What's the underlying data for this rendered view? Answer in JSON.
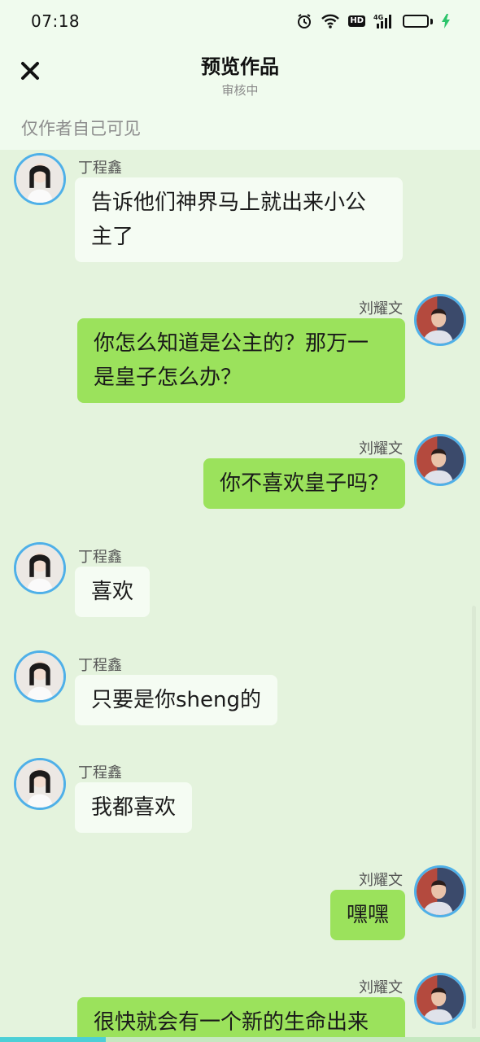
{
  "status_bar": {
    "time": "07:18",
    "icons": [
      "alarm-icon",
      "wifi-icon",
      "hd-icon",
      "4g-signal-icon",
      "battery-icon",
      "charging-icon"
    ],
    "hd_label": "HD",
    "network_label": "4G"
  },
  "header": {
    "title": "预览作品",
    "subtitle": "审核中",
    "visibility_note": "仅作者自己可见",
    "close_icon": "close-icon"
  },
  "messages": [
    {
      "side": "left",
      "sender": "丁程鑫",
      "text": "告诉他们神界马上就出来小公主了"
    },
    {
      "side": "right",
      "sender": "刘耀文",
      "text": "你怎么知道是公主的？那万一是皇子怎么办？"
    },
    {
      "side": "right",
      "sender": "刘耀文",
      "text": "你不喜欢皇子吗？"
    },
    {
      "side": "left",
      "sender": "丁程鑫",
      "text": "喜欢"
    },
    {
      "side": "left",
      "sender": "丁程鑫",
      "text": "只要是你sheng的"
    },
    {
      "side": "left",
      "sender": "丁程鑫",
      "text": "我都喜欢"
    },
    {
      "side": "right",
      "sender": "刘耀文",
      "text": "嘿嘿"
    },
    {
      "side": "right",
      "sender": "刘耀文",
      "text": "很快就会有一个新的生命出来"
    }
  ],
  "colors": {
    "background": "#e4f3dd",
    "header_bg": "#f0fbee",
    "left_bubble": "#f5fcf3",
    "right_bubble": "#9be25c",
    "avatar_ring": "#4fb0e8",
    "battery": "#2cc46b",
    "progress": "#4ccfd6"
  },
  "reading_progress": 0.22
}
